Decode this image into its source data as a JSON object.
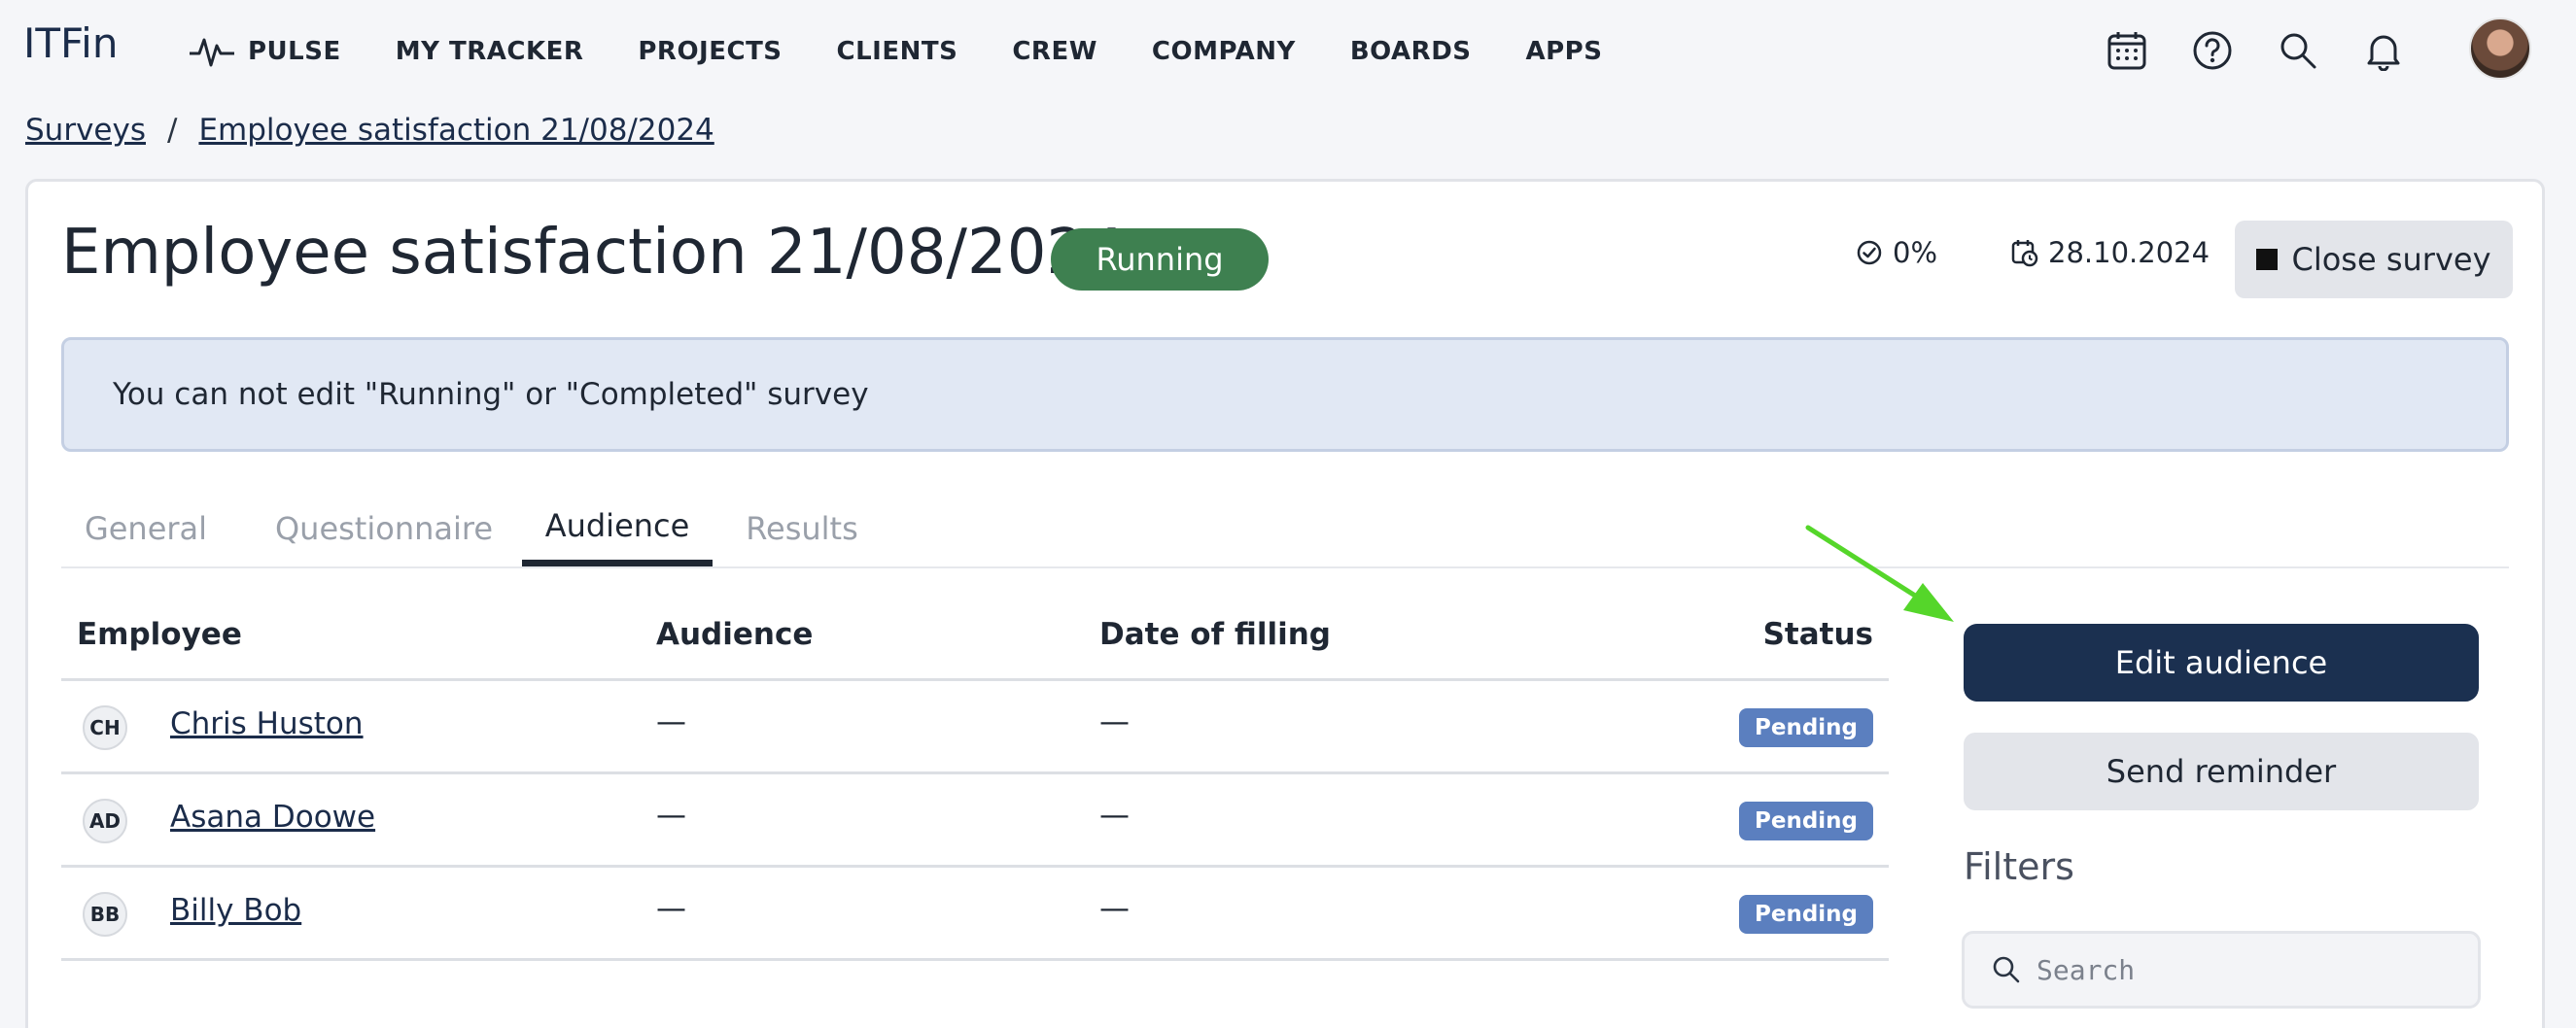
{
  "app": {
    "logo": "ITFin",
    "nav": [
      {
        "label": "PULSE",
        "icon": "pulse-icon"
      },
      {
        "label": "MY TRACKER"
      },
      {
        "label": "PROJECTS"
      },
      {
        "label": "CLIENTS"
      },
      {
        "label": "CREW"
      },
      {
        "label": "COMPANY"
      },
      {
        "label": "BOARDS"
      },
      {
        "label": "APPS"
      }
    ],
    "nav_icons": [
      "calendar-icon",
      "help-icon",
      "search-icon",
      "bell-icon"
    ]
  },
  "breadcrumb": {
    "root": "Surveys",
    "separator": "/",
    "current": "Employee satisfaction 21/08/2024"
  },
  "survey": {
    "title": "Employee satisfaction 21/08/2024",
    "status": "Running",
    "progress": "0%",
    "deadline": "28.10.2024",
    "close_label": "Close survey",
    "notice": "You can not edit \"Running\" or \"Completed\" survey"
  },
  "tabs": [
    {
      "label": "General",
      "active": false
    },
    {
      "label": "Questionnaire",
      "active": false
    },
    {
      "label": "Audience",
      "active": true
    },
    {
      "label": "Results",
      "active": false
    }
  ],
  "table": {
    "columns": {
      "employee": "Employee",
      "audience": "Audience",
      "date": "Date of filling",
      "status": "Status"
    },
    "rows": [
      {
        "initials": "CH",
        "name": "Chris Huston",
        "audience": "—",
        "date": "—",
        "status": "Pending"
      },
      {
        "initials": "AD",
        "name": "Asana Doowe",
        "audience": "—",
        "date": "—",
        "status": "Pending"
      },
      {
        "initials": "BB",
        "name": "Billy Bob",
        "audience": "—",
        "date": "—",
        "status": "Pending"
      }
    ]
  },
  "panel": {
    "edit_audience": "Edit audience",
    "send_reminder": "Send reminder",
    "filters_label": "Filters",
    "search_placeholder": "Search"
  },
  "colors": {
    "primary": "#1b3050",
    "running": "#3e8050",
    "pending": "#5b7fbf",
    "notice_bg": "#e1e8f4",
    "annotation_arrow": "#55d62a"
  }
}
